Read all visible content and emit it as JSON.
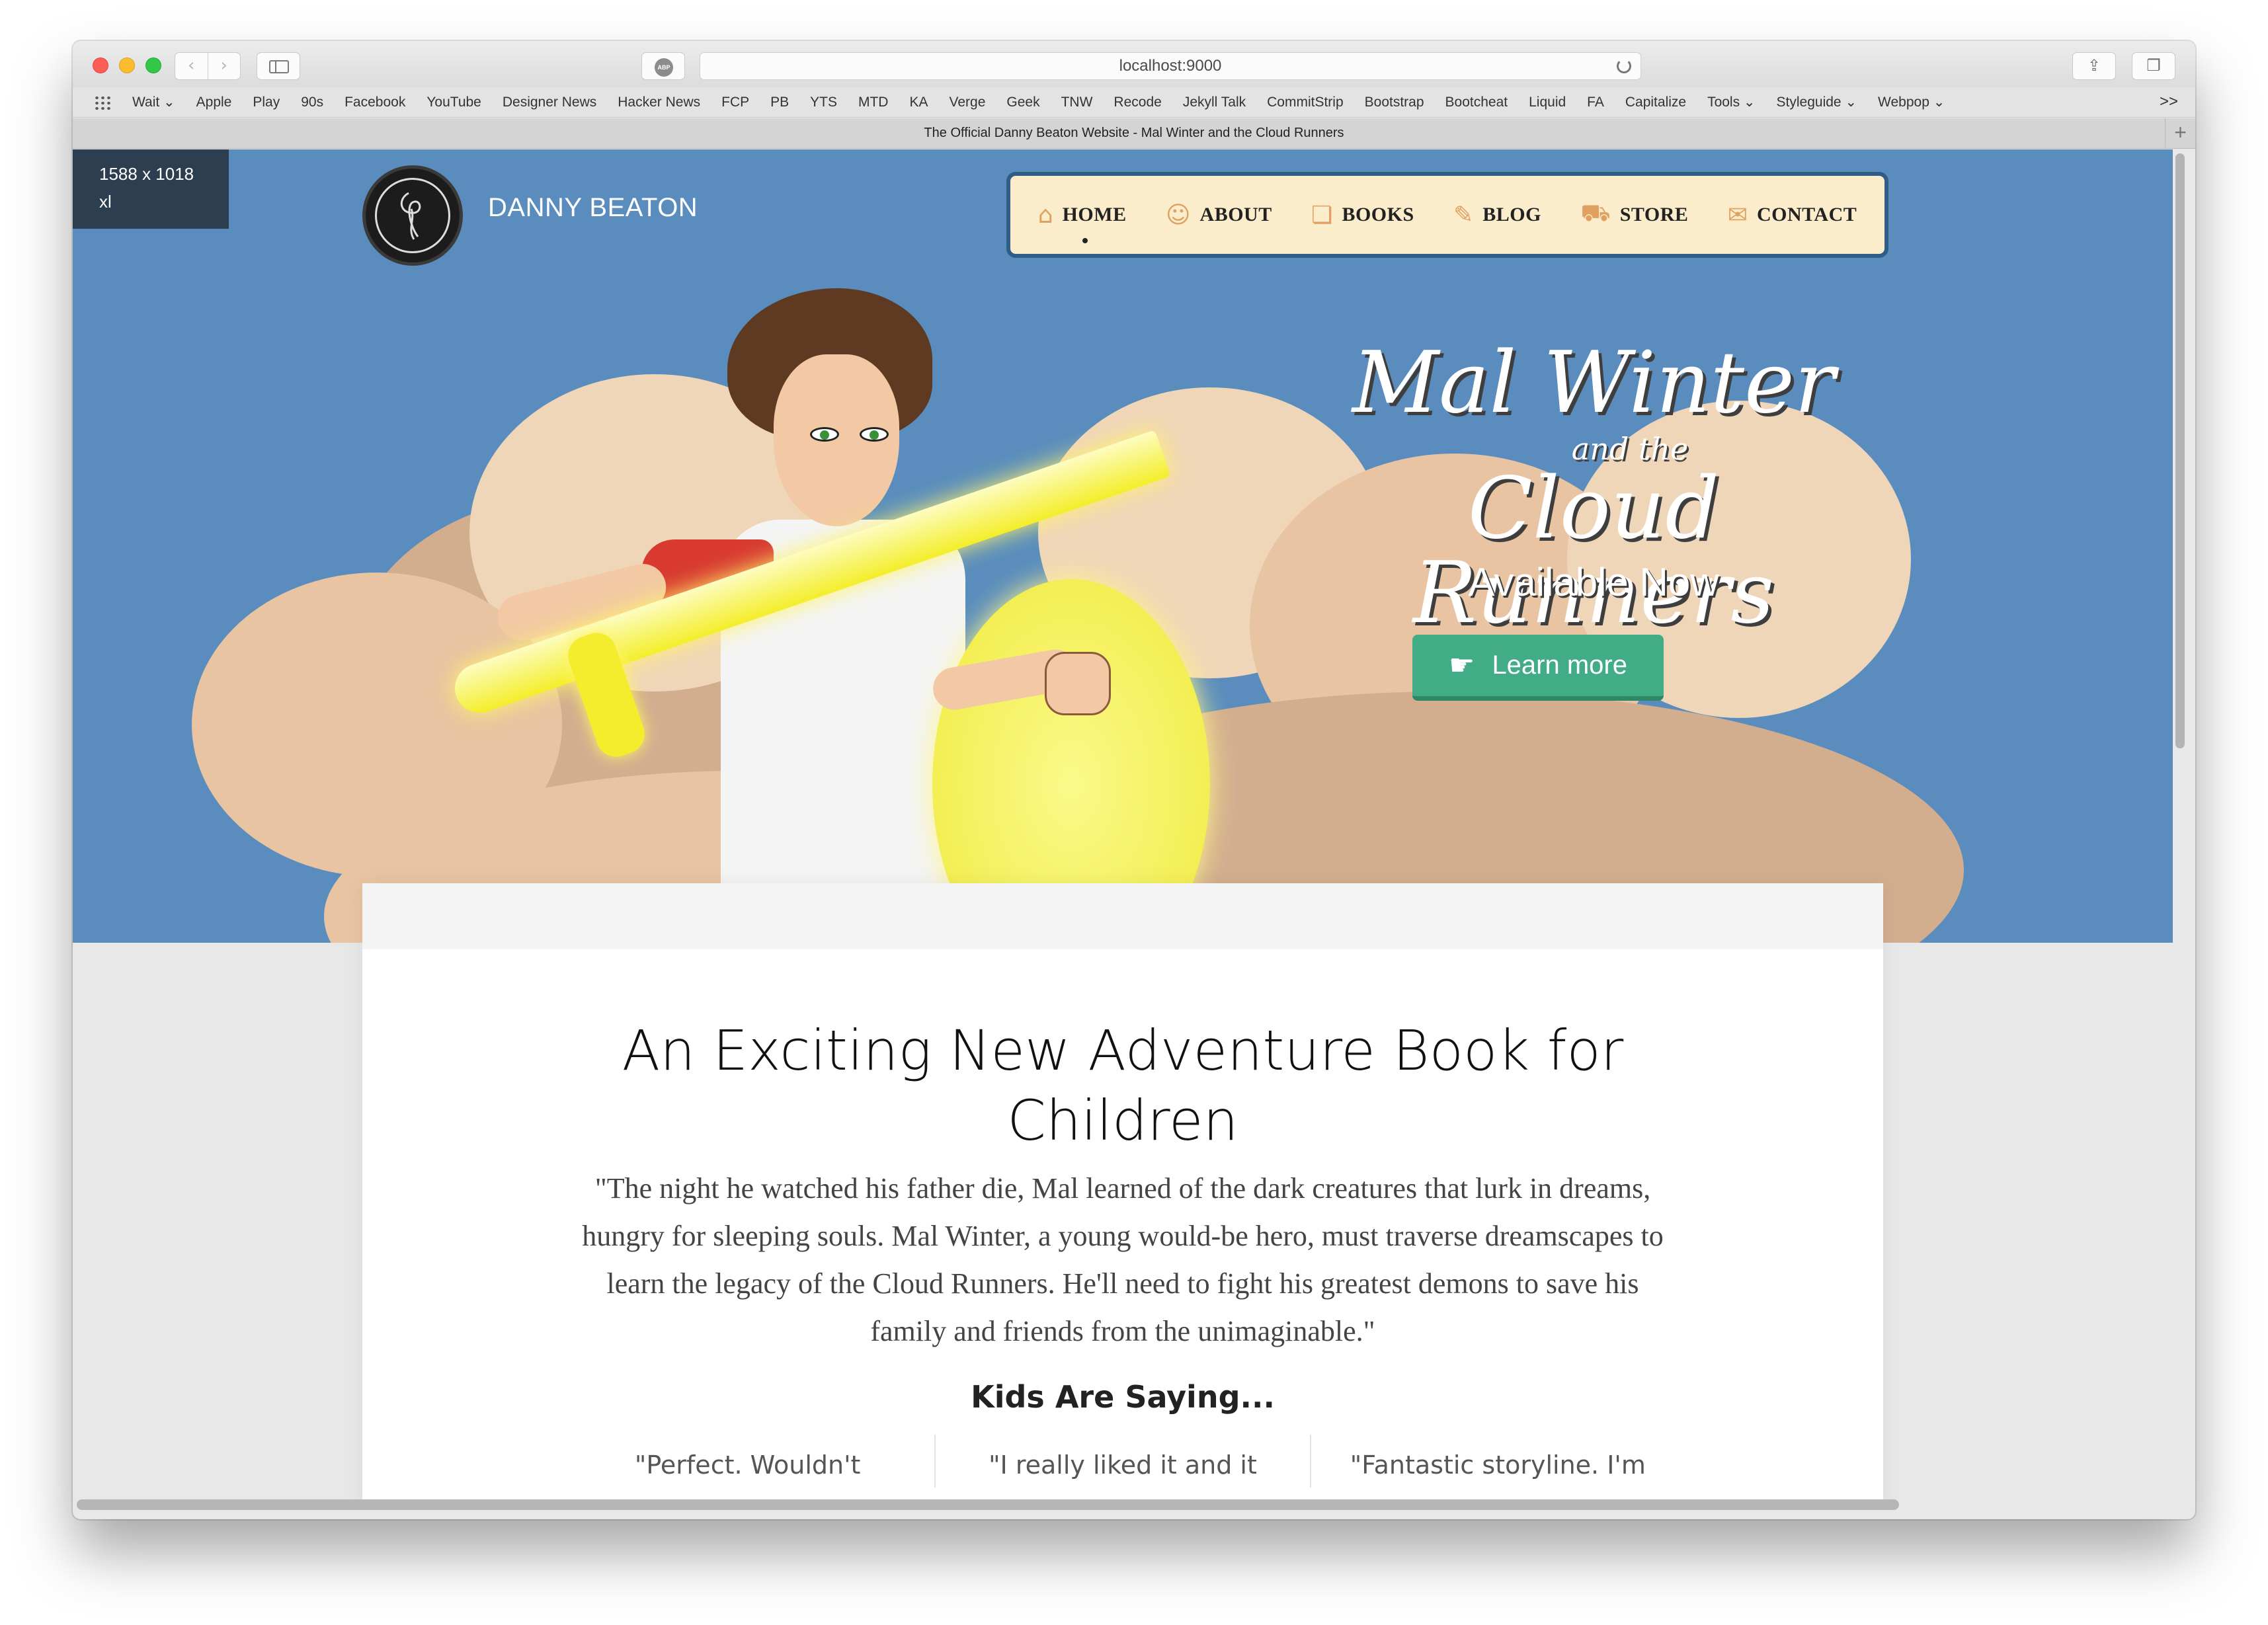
{
  "browser": {
    "url": "localhost:9000",
    "tab_title": "The Official Danny Beaton Website - Mal Winter and the Cloud Runners",
    "nav_back_icon": "chevron-left-icon",
    "nav_forward_icon": "chevron-right-icon",
    "adblock_badge": "ABP",
    "bookmarks": [
      "Wait ⌄",
      "Apple",
      "Play",
      "90s",
      "Facebook",
      "YouTube",
      "Designer News",
      "Hacker News",
      "FCP",
      "PB",
      "YTS",
      "MTD",
      "KA",
      "Verge",
      "Geek",
      "TNW",
      "Recode",
      "Jekyll Talk",
      "CommitStrip",
      "Bootstrap",
      "Bootcheat",
      "Liquid",
      "FA",
      "Capitalize",
      "Tools ⌄",
      "Styleguide ⌄",
      "Webpop ⌄"
    ],
    "bookmarks_overflow": ">>"
  },
  "debug_badge": {
    "size": "1588 x 1018",
    "breakpoint": "xl"
  },
  "site": {
    "brand_name": "DANNY BEATON",
    "nav": [
      {
        "label": "HOME",
        "icon": "home-icon",
        "active": true
      },
      {
        "label": "ABOUT",
        "icon": "user-icon",
        "active": false
      },
      {
        "label": "BOOKS",
        "icon": "book-icon",
        "active": false
      },
      {
        "label": "BLOG",
        "icon": "quill-icon",
        "active": false
      },
      {
        "label": "STORE",
        "icon": "cart-icon",
        "active": false
      },
      {
        "label": "CONTACT",
        "icon": "envelope-icon",
        "active": false
      }
    ]
  },
  "hero": {
    "title_line1": "Mal Winter",
    "title_line2": "and the",
    "title_line3": "Cloud Runners",
    "subtitle": "Available Now",
    "cta_label": "Learn more",
    "cta_icon": "thumbs-up-icon"
  },
  "content": {
    "heading": "An Exciting New Adventure Book for Children",
    "quote": "\"The night he watched his father die, Mal learned of the dark creatures that lurk in dreams, hungry for sleeping souls. Mal Winter, a young would-be hero, must traverse dreamscapes to learn the legacy of the Cloud Runners. He'll need to fight his greatest demons to save his family and friends from the unimaginable.\"",
    "kids_heading": "Kids Are Saying...",
    "testimonials": [
      "\"Perfect. Wouldn't",
      "\"I really liked it and it",
      "\"Fantastic storyline. I'm"
    ]
  },
  "colors": {
    "hero_sky": "#5a8dbd",
    "nav_background": "#fbeccb",
    "nav_border": "#2f5d87",
    "cta_green": "#41ac85"
  }
}
